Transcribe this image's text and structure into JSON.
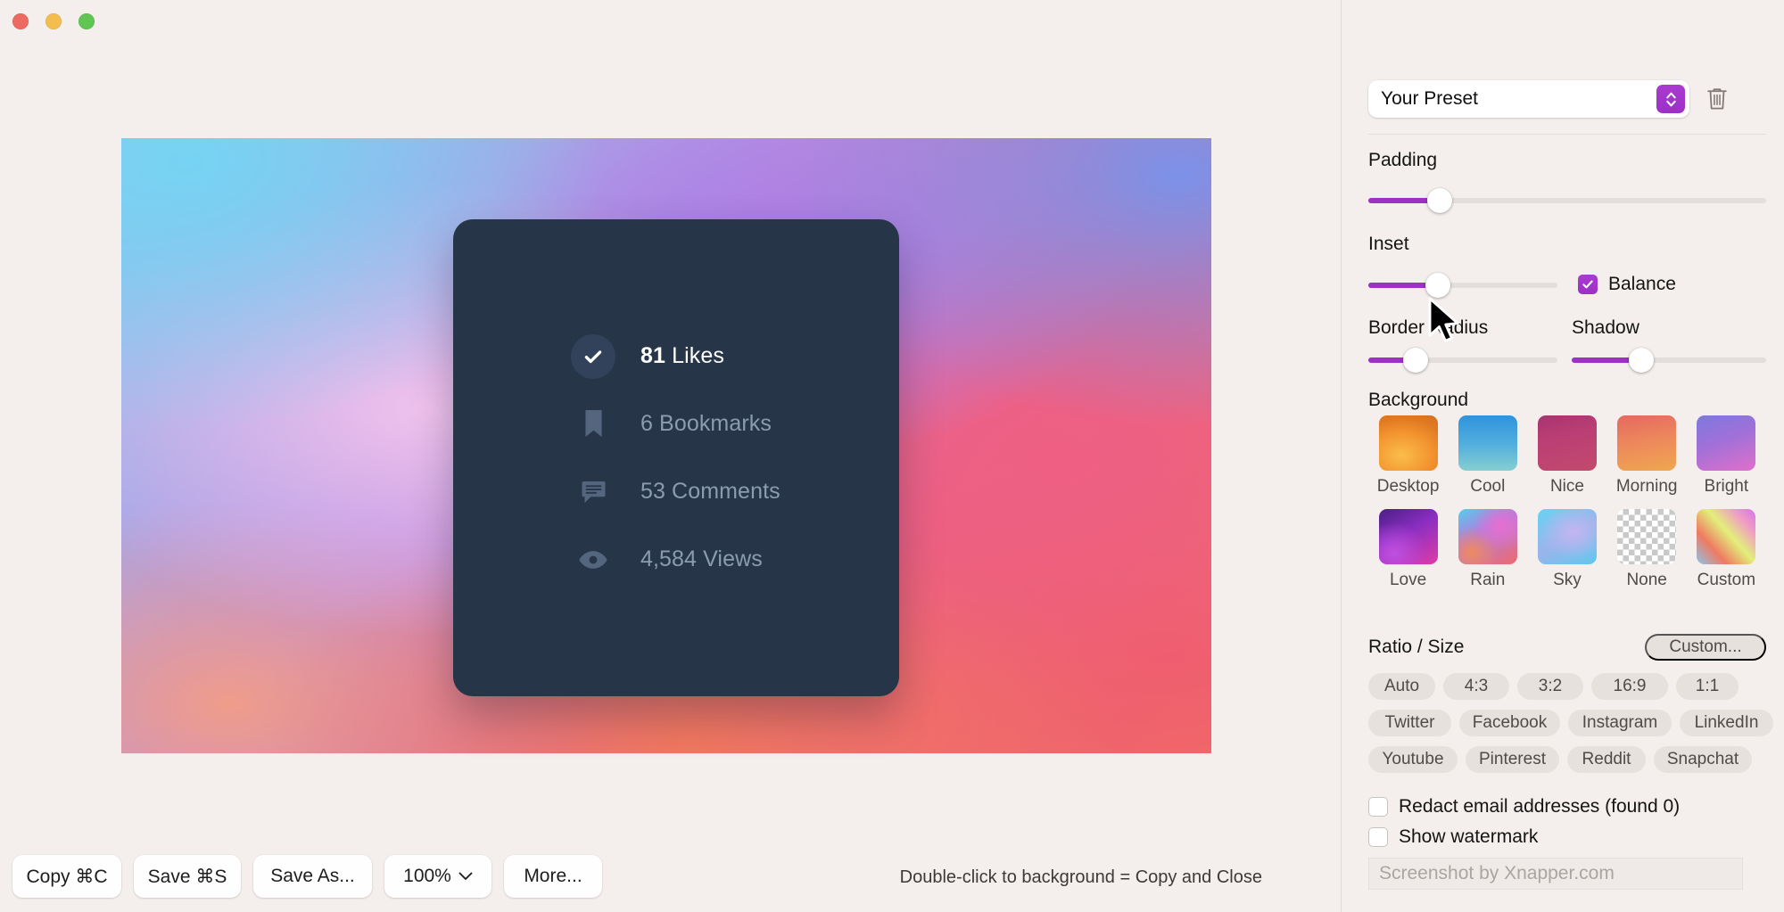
{
  "window": {
    "traffic_lights": [
      "close",
      "minimize",
      "maximize"
    ],
    "share_icon": "share-icon"
  },
  "preview": {
    "background_gradient": [
      "#76d3f2",
      "#7b92e8",
      "#f0c2ec",
      "#ef5f84",
      "#f2785f",
      "#ef5e6e"
    ],
    "card": {
      "background_color": "#273549",
      "stats": [
        {
          "icon": "check-circle-icon",
          "value": "81",
          "label": "Likes",
          "text": "81 Likes",
          "primary": true
        },
        {
          "icon": "bookmark-icon",
          "value": "6",
          "label": "Bookmarks",
          "text": "6 Bookmarks",
          "primary": false
        },
        {
          "icon": "comment-icon",
          "value": "53",
          "label": "Comments",
          "text": "53 Comments",
          "primary": false
        },
        {
          "icon": "eye-icon",
          "value": "4,584",
          "label": "Views",
          "text": "4,584 Views",
          "primary": false
        }
      ]
    }
  },
  "toolbar": {
    "copy_label": "Copy ⌘C",
    "save_label": "Save ⌘S",
    "save_as_label": "Save As...",
    "zoom_label": "100%",
    "more_label": "More...",
    "hint": "Double-click to background = Copy and Close"
  },
  "sidebar": {
    "preset": {
      "value": "Your Preset",
      "stepper_icon": "chevron-up-down-icon",
      "delete_icon": "trash-icon",
      "accent_color": "#9c2fc6"
    },
    "padding": {
      "label": "Padding",
      "value": 18
    },
    "inset": {
      "label": "Inset",
      "value": 37
    },
    "balance": {
      "label": "Balance",
      "checked": true,
      "color": "#2c4258"
    },
    "border_radius": {
      "label": "Border Radius",
      "value": 25
    },
    "shadow": {
      "label": "Shadow",
      "value": 36
    },
    "background": {
      "label": "Background",
      "items": [
        {
          "name": "Desktop",
          "key": "desktop"
        },
        {
          "name": "Cool",
          "key": "cool"
        },
        {
          "name": "Nice",
          "key": "nice"
        },
        {
          "name": "Morning",
          "key": "morning"
        },
        {
          "name": "Bright",
          "key": "bright"
        },
        {
          "name": "Love",
          "key": "love"
        },
        {
          "name": "Rain",
          "key": "rain"
        },
        {
          "name": "Sky",
          "key": "sky"
        },
        {
          "name": "None",
          "key": "none"
        },
        {
          "name": "Custom",
          "key": "custom"
        }
      ]
    },
    "ratio": {
      "label": "Ratio / Size",
      "custom_label": "Custom...",
      "row1": [
        "Auto",
        "4:3",
        "3:2",
        "16:9",
        "1:1"
      ],
      "row2": [
        "Twitter",
        "Facebook",
        "Instagram",
        "LinkedIn"
      ],
      "row3": [
        "Youtube",
        "Pinterest",
        "Reddit",
        "Snapchat"
      ]
    },
    "redact": {
      "label": "Redact email addresses (found 0)",
      "checked": false
    },
    "watermark": {
      "label": "Show watermark",
      "checked": false,
      "placeholder": "Screenshot by Xnapper.com"
    }
  }
}
